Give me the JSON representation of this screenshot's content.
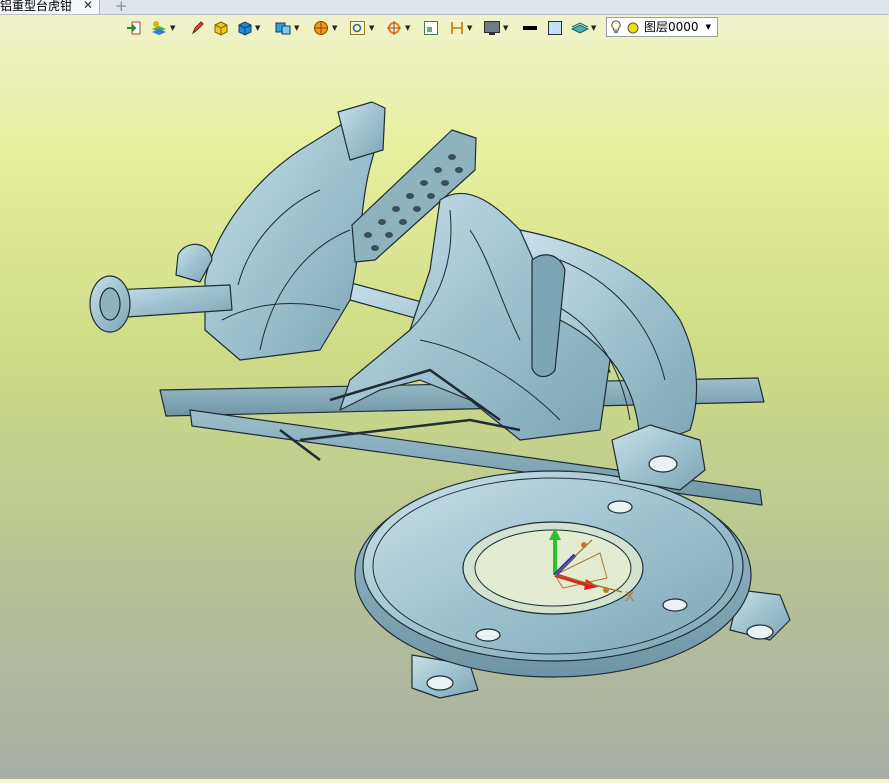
{
  "document_tab": {
    "title": "铝重型台虎钳",
    "close_glyph": "✕",
    "add_glyph": "+"
  },
  "toolbar": {
    "items": [
      {
        "name": "import-icon"
      },
      {
        "name": "layers-manager-icon",
        "dropdown": true
      },
      {
        "name": "pen-icon"
      },
      {
        "name": "box-yellow-icon"
      },
      {
        "name": "box-blue-icon",
        "dropdown": true
      },
      {
        "name": "solid-view-icon",
        "dropdown": true
      },
      {
        "name": "sphere-orange-icon",
        "dropdown": true
      },
      {
        "name": "zoom-window-icon",
        "dropdown": true
      },
      {
        "name": "target-icon",
        "dropdown": true
      },
      {
        "name": "square-frame-icon"
      },
      {
        "name": "dimension-icon",
        "dropdown": true
      },
      {
        "name": "display-monitor-icon",
        "dropdown": true
      },
      {
        "name": "line-black-icon"
      },
      {
        "name": "fill-color-icon"
      },
      {
        "name": "layer-style-icon",
        "dropdown": true
      }
    ],
    "layer_selector": {
      "value": "图层0000",
      "icon_bulb": "lightbulb-icon",
      "icon_color": "layer-color-dot-icon"
    }
  },
  "viewport": {
    "triad": {
      "x_label": "X"
    },
    "colors": {
      "model_fill": "#a9c9d6",
      "model_edge": "#1e2d36",
      "bg_top": "#f2f3d0",
      "bg_bottom": "#a8aea5"
    }
  }
}
